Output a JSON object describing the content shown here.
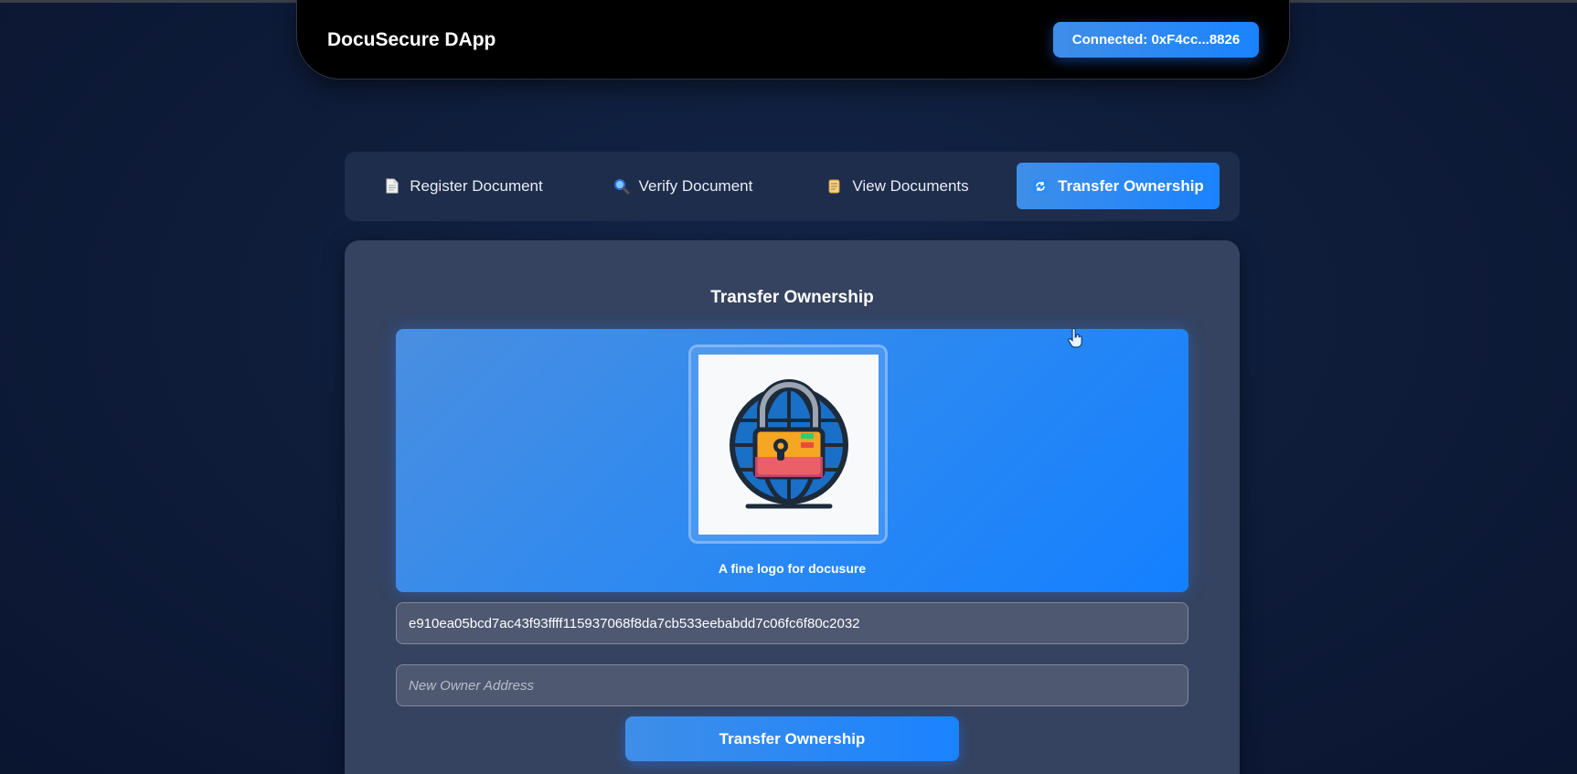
{
  "header": {
    "app_title": "DocuSecure DApp",
    "wallet_label": "Connected: 0xF4cc...8826"
  },
  "tabs": [
    {
      "label": "Register Document",
      "icon": "document-icon"
    },
    {
      "label": "Verify Document",
      "icon": "magnifier-icon"
    },
    {
      "label": "View Documents",
      "icon": "scroll-icon"
    },
    {
      "label": "Transfer Ownership",
      "icon": "refresh-icon",
      "active": true
    }
  ],
  "panel": {
    "title": "Transfer Ownership",
    "preview": {
      "image": "padlock-globe-logo",
      "caption": "A fine logo for docusure"
    },
    "hash_value": "e910ea05bcd7ac43f93ffff115937068f8da7cb533eebabdd7c06fc6f80c2032",
    "owner_placeholder": "New Owner Address",
    "owner_value": "",
    "submit_label": "Transfer Ownership"
  },
  "colors": {
    "accent": "#1a83ff",
    "background": "#0f1d3b",
    "panel": "#354360"
  }
}
